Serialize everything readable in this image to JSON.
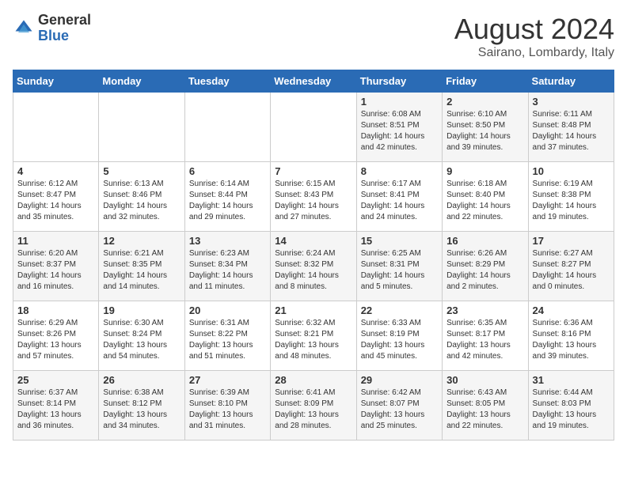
{
  "header": {
    "logo_general": "General",
    "logo_blue": "Blue",
    "title": "August 2024",
    "subtitle": "Sairano, Lombardy, Italy"
  },
  "weekdays": [
    "Sunday",
    "Monday",
    "Tuesday",
    "Wednesday",
    "Thursday",
    "Friday",
    "Saturday"
  ],
  "weeks": [
    [
      {
        "day": "",
        "info": ""
      },
      {
        "day": "",
        "info": ""
      },
      {
        "day": "",
        "info": ""
      },
      {
        "day": "",
        "info": ""
      },
      {
        "day": "1",
        "info": "Sunrise: 6:08 AM\nSunset: 8:51 PM\nDaylight: 14 hours\nand 42 minutes."
      },
      {
        "day": "2",
        "info": "Sunrise: 6:10 AM\nSunset: 8:50 PM\nDaylight: 14 hours\nand 39 minutes."
      },
      {
        "day": "3",
        "info": "Sunrise: 6:11 AM\nSunset: 8:48 PM\nDaylight: 14 hours\nand 37 minutes."
      }
    ],
    [
      {
        "day": "4",
        "info": "Sunrise: 6:12 AM\nSunset: 8:47 PM\nDaylight: 14 hours\nand 35 minutes."
      },
      {
        "day": "5",
        "info": "Sunrise: 6:13 AM\nSunset: 8:46 PM\nDaylight: 14 hours\nand 32 minutes."
      },
      {
        "day": "6",
        "info": "Sunrise: 6:14 AM\nSunset: 8:44 PM\nDaylight: 14 hours\nand 29 minutes."
      },
      {
        "day": "7",
        "info": "Sunrise: 6:15 AM\nSunset: 8:43 PM\nDaylight: 14 hours\nand 27 minutes."
      },
      {
        "day": "8",
        "info": "Sunrise: 6:17 AM\nSunset: 8:41 PM\nDaylight: 14 hours\nand 24 minutes."
      },
      {
        "day": "9",
        "info": "Sunrise: 6:18 AM\nSunset: 8:40 PM\nDaylight: 14 hours\nand 22 minutes."
      },
      {
        "day": "10",
        "info": "Sunrise: 6:19 AM\nSunset: 8:38 PM\nDaylight: 14 hours\nand 19 minutes."
      }
    ],
    [
      {
        "day": "11",
        "info": "Sunrise: 6:20 AM\nSunset: 8:37 PM\nDaylight: 14 hours\nand 16 minutes."
      },
      {
        "day": "12",
        "info": "Sunrise: 6:21 AM\nSunset: 8:35 PM\nDaylight: 14 hours\nand 14 minutes."
      },
      {
        "day": "13",
        "info": "Sunrise: 6:23 AM\nSunset: 8:34 PM\nDaylight: 14 hours\nand 11 minutes."
      },
      {
        "day": "14",
        "info": "Sunrise: 6:24 AM\nSunset: 8:32 PM\nDaylight: 14 hours\nand 8 minutes."
      },
      {
        "day": "15",
        "info": "Sunrise: 6:25 AM\nSunset: 8:31 PM\nDaylight: 14 hours\nand 5 minutes."
      },
      {
        "day": "16",
        "info": "Sunrise: 6:26 AM\nSunset: 8:29 PM\nDaylight: 14 hours\nand 2 minutes."
      },
      {
        "day": "17",
        "info": "Sunrise: 6:27 AM\nSunset: 8:27 PM\nDaylight: 14 hours\nand 0 minutes."
      }
    ],
    [
      {
        "day": "18",
        "info": "Sunrise: 6:29 AM\nSunset: 8:26 PM\nDaylight: 13 hours\nand 57 minutes."
      },
      {
        "day": "19",
        "info": "Sunrise: 6:30 AM\nSunset: 8:24 PM\nDaylight: 13 hours\nand 54 minutes."
      },
      {
        "day": "20",
        "info": "Sunrise: 6:31 AM\nSunset: 8:22 PM\nDaylight: 13 hours\nand 51 minutes."
      },
      {
        "day": "21",
        "info": "Sunrise: 6:32 AM\nSunset: 8:21 PM\nDaylight: 13 hours\nand 48 minutes."
      },
      {
        "day": "22",
        "info": "Sunrise: 6:33 AM\nSunset: 8:19 PM\nDaylight: 13 hours\nand 45 minutes."
      },
      {
        "day": "23",
        "info": "Sunrise: 6:35 AM\nSunset: 8:17 PM\nDaylight: 13 hours\nand 42 minutes."
      },
      {
        "day": "24",
        "info": "Sunrise: 6:36 AM\nSunset: 8:16 PM\nDaylight: 13 hours\nand 39 minutes."
      }
    ],
    [
      {
        "day": "25",
        "info": "Sunrise: 6:37 AM\nSunset: 8:14 PM\nDaylight: 13 hours\nand 36 minutes."
      },
      {
        "day": "26",
        "info": "Sunrise: 6:38 AM\nSunset: 8:12 PM\nDaylight: 13 hours\nand 34 minutes."
      },
      {
        "day": "27",
        "info": "Sunrise: 6:39 AM\nSunset: 8:10 PM\nDaylight: 13 hours\nand 31 minutes."
      },
      {
        "day": "28",
        "info": "Sunrise: 6:41 AM\nSunset: 8:09 PM\nDaylight: 13 hours\nand 28 minutes."
      },
      {
        "day": "29",
        "info": "Sunrise: 6:42 AM\nSunset: 8:07 PM\nDaylight: 13 hours\nand 25 minutes."
      },
      {
        "day": "30",
        "info": "Sunrise: 6:43 AM\nSunset: 8:05 PM\nDaylight: 13 hours\nand 22 minutes."
      },
      {
        "day": "31",
        "info": "Sunrise: 6:44 AM\nSunset: 8:03 PM\nDaylight: 13 hours\nand 19 minutes."
      }
    ]
  ]
}
